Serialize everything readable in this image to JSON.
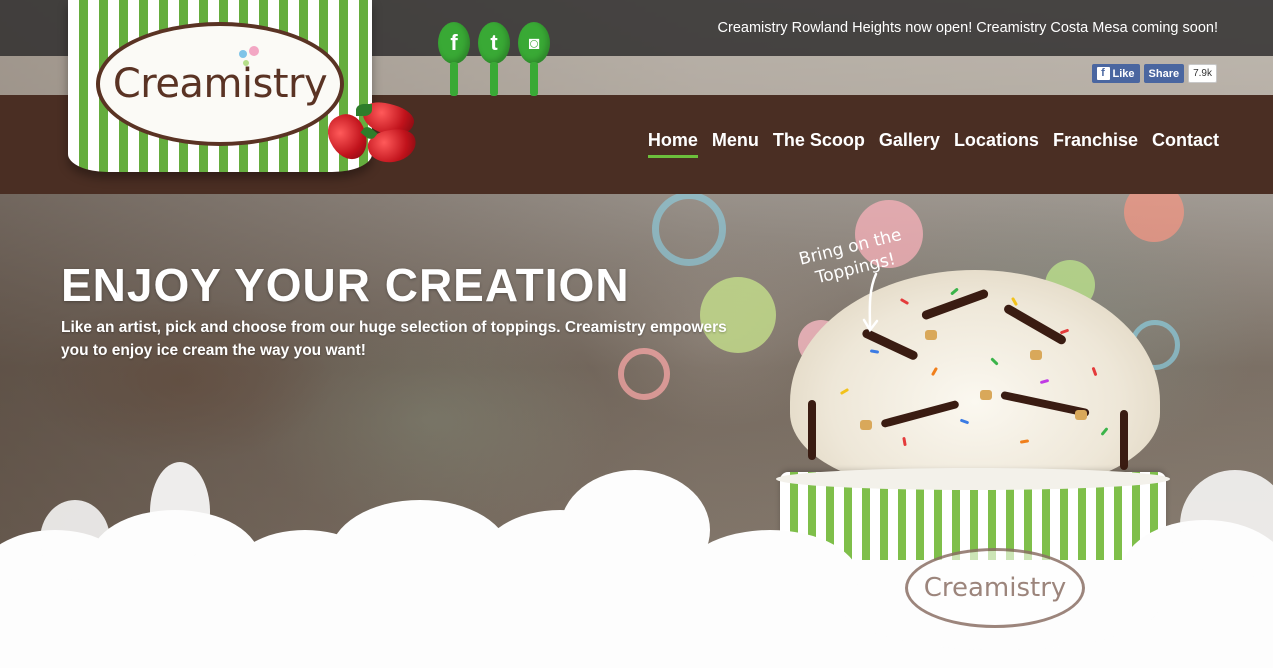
{
  "announcement": "Creamistry Rowland Heights now open! Creamistry Costa Mesa coming soon!",
  "logo": {
    "text": "Creamistry"
  },
  "social": [
    {
      "name": "facebook",
      "glyph": "f"
    },
    {
      "name": "tumblr",
      "glyph": "t"
    },
    {
      "name": "instagram",
      "glyph": "◙"
    }
  ],
  "facebook_widget": {
    "like_label": "Like",
    "like_glyph": "f",
    "share_label": "Share",
    "count": "7.9k"
  },
  "nav": [
    {
      "label": "Home",
      "active": true
    },
    {
      "label": "Menu",
      "active": false
    },
    {
      "label": "The Scoop",
      "active": false
    },
    {
      "label": "Gallery",
      "active": false
    },
    {
      "label": "Locations",
      "active": false
    },
    {
      "label": "Franchise",
      "active": false
    },
    {
      "label": "Contact",
      "active": false
    }
  ],
  "hero": {
    "title": "ENJOY YOUR CREATION",
    "subtitle": "Like an artist, pick and choose from our huge selection of toppings. Creamistry empowers you to enjoy ice cream the way you want!",
    "callout_line1": "Bring on the",
    "callout_line2": "Toppings!",
    "cup_text": "Creamistry"
  },
  "colors": {
    "nav_bg": "#4a2e23",
    "accent_green": "#6cbf3c",
    "brand_brown": "#5a3324",
    "facebook_blue": "#4a66a0"
  }
}
